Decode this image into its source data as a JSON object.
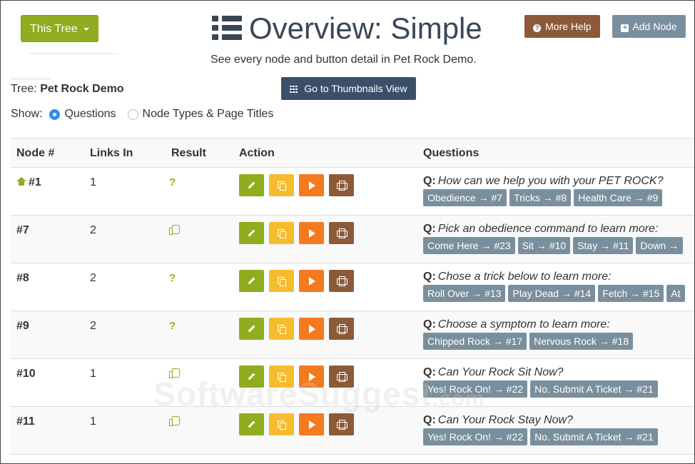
{
  "header": {
    "tree_button": "This Tree",
    "title": "Overview: Simple",
    "subtitle": "See every node and button detail in Pet Rock Demo.",
    "more_help": "More Help",
    "add_node": "Add Node",
    "thumbnails": "Go to Thumbnails View"
  },
  "tree": {
    "label": "Tree:",
    "name": "Pet Rock Demo"
  },
  "show": {
    "label": "Show:",
    "opt1": "Questions",
    "opt2": "Node Types & Page Titles",
    "selected": "Questions"
  },
  "table": {
    "headers": [
      "Node #",
      "Links In",
      "Result",
      "Action",
      "Questions"
    ],
    "rows": [
      {
        "node": "#1",
        "home": true,
        "links": "1",
        "result": "?",
        "q_prefix": "Q:",
        "question": "How can we help you with your PET ROCK?",
        "answers": [
          "Obedience → #7",
          "Tricks → #8",
          "Health Care → #9"
        ]
      },
      {
        "node": "#7",
        "links": "2",
        "result": "thumbs-up",
        "q_prefix": "Q:",
        "question": "Pick an obedience command to learn more:",
        "answers": [
          "Come Here → #23",
          "Sit → #10",
          "Stay → #11",
          "Down →"
        ]
      },
      {
        "node": "#8",
        "links": "2",
        "result": "?",
        "q_prefix": "Q:",
        "question": "Chose a trick below to learn more:",
        "answers": [
          "Roll Over → #13",
          "Play Dead → #14",
          "Fetch → #15",
          "At"
        ]
      },
      {
        "node": "#9",
        "links": "2",
        "result": "?",
        "q_prefix": "Q:",
        "question": "Choose a symptom to learn more:",
        "answers": [
          "Chipped Rock → #17",
          "Nervous Rock → #18"
        ]
      },
      {
        "node": "#10",
        "links": "1",
        "result": "thumbs-up",
        "q_prefix": "Q:",
        "question": "Can Your Rock Sit Now?",
        "answers": [
          "Yes! Rock On! → #22",
          "No. Submit A Ticket → #21"
        ]
      },
      {
        "node": "#11",
        "links": "1",
        "result": "thumbs-up",
        "q_prefix": "Q:",
        "question": "Can Your Rock Stay Now?",
        "answers": [
          "Yes! Rock On! → #22",
          "No. Submit A Ticket → #21"
        ]
      }
    ]
  },
  "watermark": {
    "text": "SoftwareSuggest",
    "suffix": ".com"
  },
  "colors": {
    "green": "#8fad1e",
    "yellow": "#f6bc2f",
    "orange": "#f47a20",
    "brown": "#8c5a38",
    "chip": "#7a8f9e",
    "navy": "#3b5068"
  }
}
